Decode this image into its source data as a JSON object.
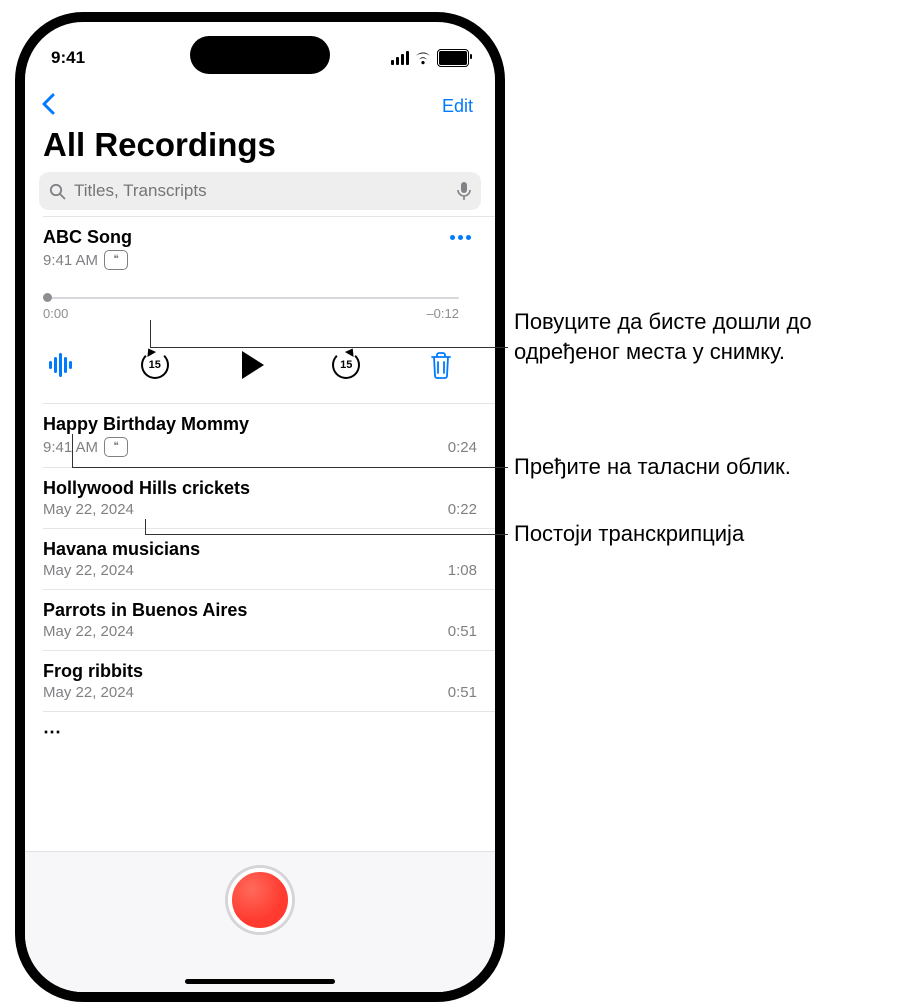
{
  "status": {
    "time": "9:41"
  },
  "nav": {
    "edit_label": "Edit"
  },
  "page_title": "All Recordings",
  "search": {
    "placeholder": "Titles, Transcripts"
  },
  "expanded": {
    "title": "ABC Song",
    "time": "9:41 AM",
    "start": "0:00",
    "end": "–0:12",
    "skip_amount": "15"
  },
  "recordings": [
    {
      "title": "Happy Birthday Mommy",
      "sub": "9:41 AM",
      "duration": "0:24",
      "has_transcript": true
    },
    {
      "title": "Hollywood Hills crickets",
      "sub": "May 22, 2024",
      "duration": "0:22",
      "has_transcript": false
    },
    {
      "title": "Havana musicians",
      "sub": "May 22, 2024",
      "duration": "1:08",
      "has_transcript": false
    },
    {
      "title": "Parrots in Buenos Aires",
      "sub": "May 22, 2024",
      "duration": "0:51",
      "has_transcript": false
    },
    {
      "title": "Frog ribbits",
      "sub": "May 22, 2024",
      "duration": "0:51",
      "has_transcript": false
    }
  ],
  "callouts": {
    "scrub": "Повуците да бисте дошли до одређеног места у снимку.",
    "waveform": "Пређите на таласни облик.",
    "transcript": "Постоји транскрипција"
  }
}
